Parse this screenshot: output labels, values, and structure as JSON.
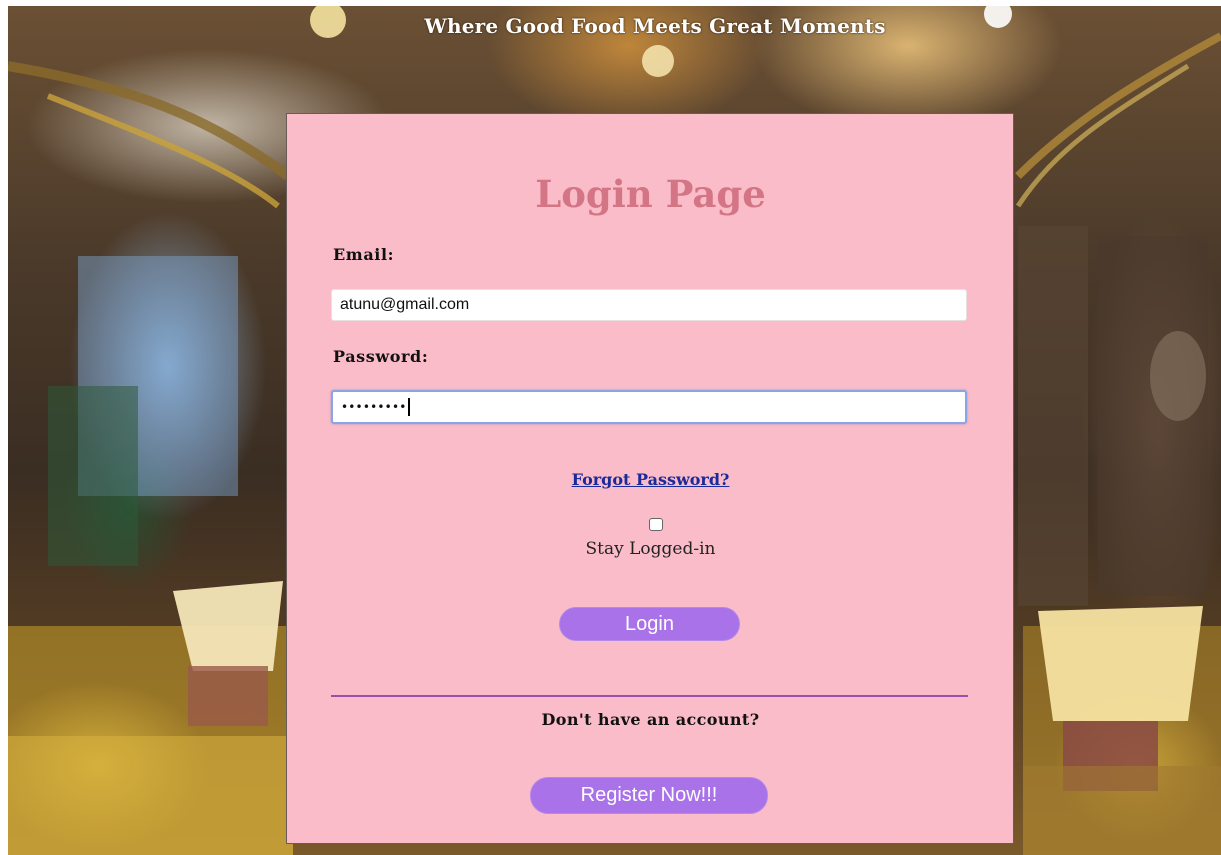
{
  "header": {
    "tagline": "Where Good Food Meets Great Moments"
  },
  "login_card": {
    "title": "Login Page",
    "email_label": "Email:",
    "email_value": "atunu@gmail.com",
    "password_label": "Password:",
    "password_masked": "•••••••••",
    "forgot_link": "Forgot Password?",
    "stay_logged_in_label": "Stay Logged-in",
    "stay_logged_in_checked": false,
    "login_button": "Login",
    "no_account_text": "Don't have an account?",
    "register_button": "Register Now!!!"
  },
  "colors": {
    "card_background": "#f9bcc8",
    "title": "#d47586",
    "button": "#a972e8",
    "link": "#1a2a9a",
    "divider": "#9a4fa8"
  }
}
